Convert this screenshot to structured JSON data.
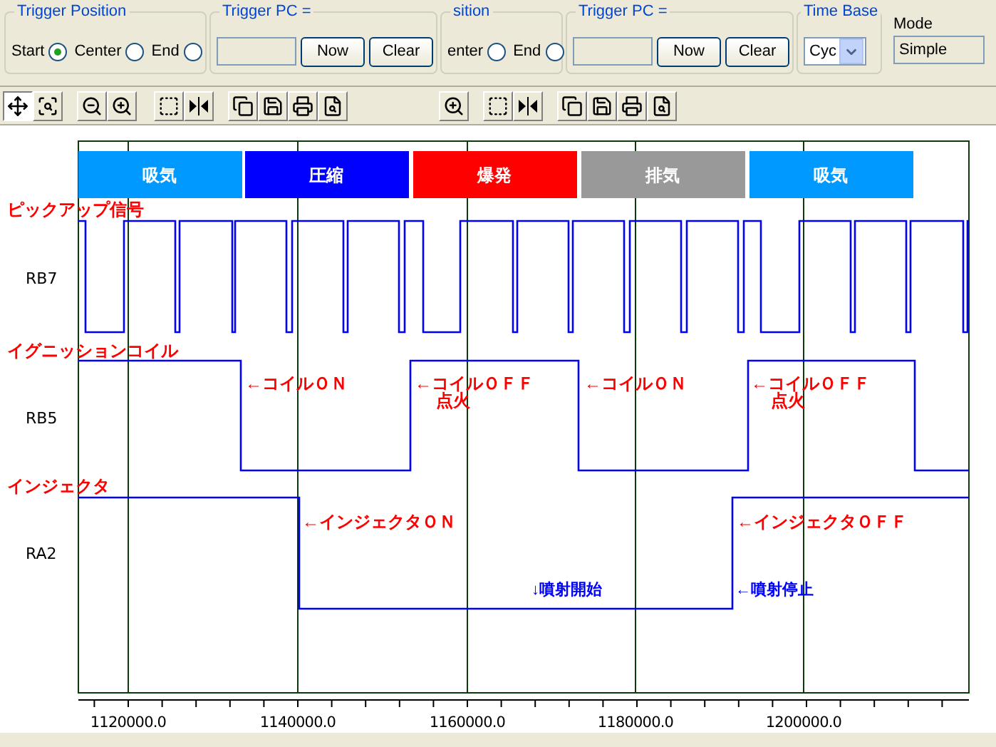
{
  "top_panel": {
    "groups": [
      {
        "kind": "trigger_position",
        "title": "Trigger Position",
        "options": [
          {
            "label": "Start",
            "selected": true
          },
          {
            "label": "Center",
            "selected": false
          },
          {
            "label": "End",
            "selected": false
          }
        ]
      },
      {
        "kind": "trigger_pc",
        "title": "Trigger PC =",
        "buttons": [
          "Now",
          "Clear"
        ]
      },
      {
        "kind": "trigger_position",
        "title": "sition",
        "options": [
          {
            "label": "enter",
            "selected": false
          },
          {
            "label": "End",
            "selected": false
          }
        ]
      },
      {
        "kind": "trigger_pc",
        "title": "Trigger PC =",
        "buttons": [
          "Now",
          "Clear"
        ]
      },
      {
        "kind": "time_base",
        "title": "Time Base",
        "value": "Cyc"
      }
    ],
    "mode": {
      "label": "Mode",
      "value": "Simple"
    }
  },
  "toolbars": [
    {
      "tools": [
        {
          "kind": "pan",
          "selected": true
        },
        {
          "kind": "zoom_fit",
          "selected": false
        },
        {
          "kind": "zoom_out",
          "selected": false
        },
        {
          "kind": "zoom_in",
          "selected": false
        },
        {
          "kind": "select",
          "selected": false
        },
        {
          "kind": "split",
          "selected": false
        },
        {
          "kind": "copy",
          "selected": false
        },
        {
          "kind": "save",
          "selected": false
        },
        {
          "kind": "print",
          "selected": false
        },
        {
          "kind": "preview",
          "selected": false
        }
      ]
    },
    {
      "tools": [
        {
          "kind": "zoom_in",
          "selected": false
        },
        {
          "kind": "select",
          "selected": false
        },
        {
          "kind": "split",
          "selected": false
        },
        {
          "kind": "copy",
          "selected": false
        },
        {
          "kind": "save",
          "selected": false
        },
        {
          "kind": "print",
          "selected": false
        },
        {
          "kind": "preview",
          "selected": false
        }
      ]
    }
  ],
  "chart": {
    "phases": [
      {
        "label": "吸気",
        "color": "#0099ff"
      },
      {
        "label": "圧縮",
        "color": "#0000ff"
      },
      {
        "label": "爆発",
        "color": "#ff0000"
      },
      {
        "label": "排気",
        "color": "#999999"
      },
      {
        "label": "吸気",
        "color": "#0099ff"
      }
    ],
    "signals": [
      {
        "title": "ピックアップ信号",
        "name": "RB7"
      },
      {
        "title": "イグニッションコイル",
        "name": "RB5"
      },
      {
        "title": "インジェクタ",
        "name": "RA2"
      }
    ],
    "annotations": [
      {
        "text": "←コイルＯＮ",
        "color": "#ff0000"
      },
      {
        "text": "←コイルＯＦＦ",
        "color": "#ff0000"
      },
      {
        "text": "点火",
        "color": "#ff0000"
      },
      {
        "text": "←コイルＯＮ",
        "color": "#ff0000"
      },
      {
        "text": "←コイルＯＦＦ",
        "color": "#ff0000"
      },
      {
        "text": "点火",
        "color": "#ff0000"
      },
      {
        "text": "←インジェクタＯＮ",
        "color": "#ff0000"
      },
      {
        "text": "←インジェクタＯＦＦ",
        "color": "#ff0000"
      },
      {
        "text": "↓噴射開始",
        "color": "#0000ff"
      },
      {
        "text": "←噴射停止",
        "color": "#0000ff"
      }
    ],
    "x_tick_labels": [
      "1120000.0",
      "1140000.0",
      "1160000.0",
      "1180000.0",
      "1200000.0"
    ]
  }
}
